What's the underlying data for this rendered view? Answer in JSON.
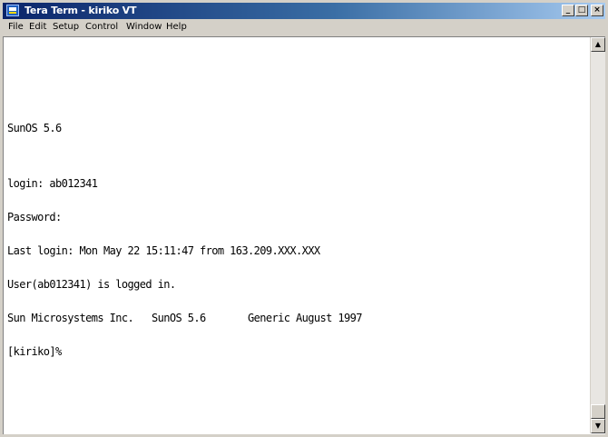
{
  "window": {
    "title": "Tera Term - kiriko VT",
    "buttons": {
      "minimize": "_",
      "maximize": "□",
      "close": "×"
    }
  },
  "menu": [
    "File",
    "Edit",
    "Setup",
    "Control",
    "Window",
    "Help"
  ],
  "terminal": {
    "lines": [
      "",
      "",
      "SunOS 5.6",
      "",
      "login: ab012341",
      "Password:",
      "Last login: Mon May 22 15:11:47 from 163.209.XXX.XXX",
      "User(ab012341) is logged in.",
      "Sun Microsystems Inc.   SunOS 5.6       Generic August 1997",
      "[kiriko]%"
    ]
  },
  "scrollbar": {
    "up_icon": "▲",
    "down_icon": "▼"
  },
  "colors": {
    "title_start": "#0a246a",
    "title_end": "#a6caf0",
    "chrome": "#d4d0c8",
    "terminal_bg": "#ffffff",
    "terminal_fg": "#000000"
  }
}
